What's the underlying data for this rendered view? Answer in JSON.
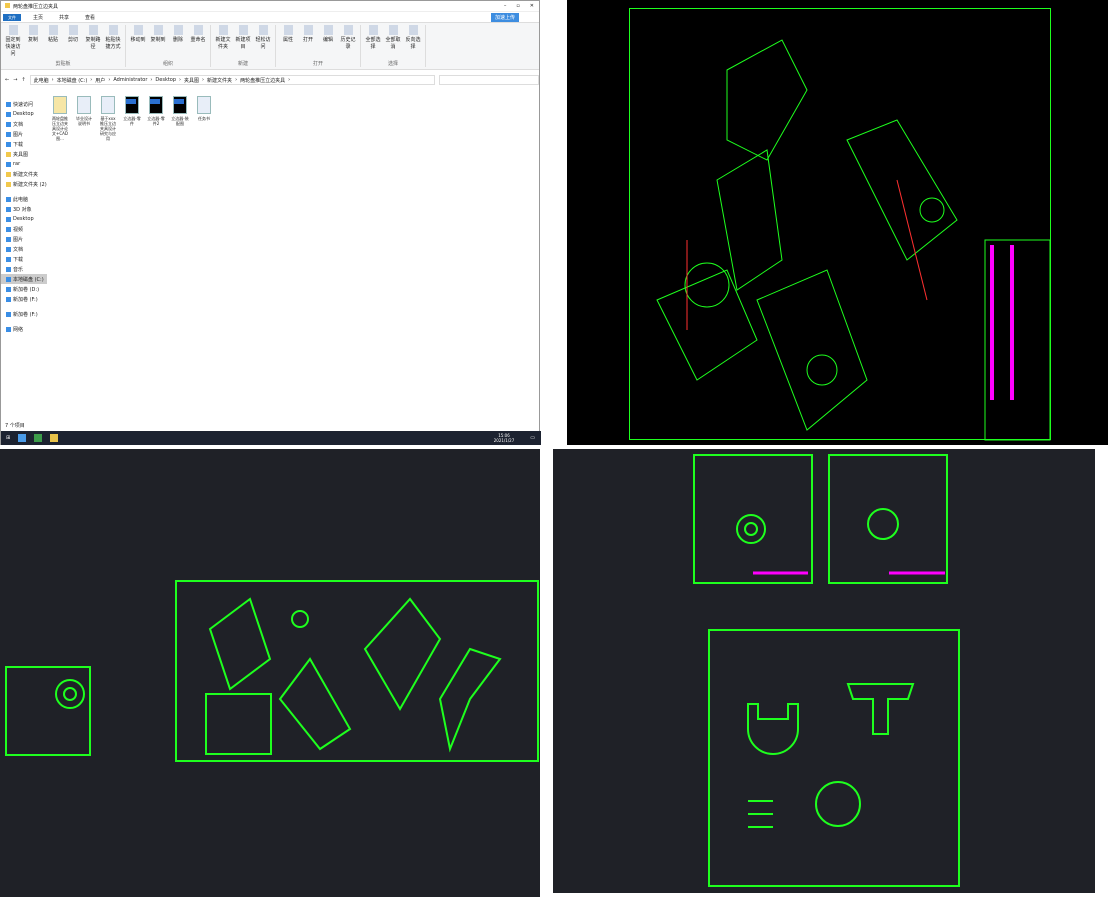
{
  "explorer": {
    "title": "两轮盘推压立边夹具",
    "tabs": [
      "文件",
      "主页",
      "共享",
      "查看"
    ],
    "ribbon": {
      "groups": [
        {
          "label": "剪贴板",
          "buttons": [
            "固定到快速访问",
            "复制",
            "粘贴",
            "剪切",
            "复制路径",
            "粘贴快捷方式"
          ]
        },
        {
          "label": "组织",
          "buttons": [
            "移动到",
            "复制到",
            "删除",
            "重命名"
          ]
        },
        {
          "label": "新建",
          "buttons": [
            "新建文件夹",
            "新建项目",
            "轻松访问"
          ]
        },
        {
          "label": "打开",
          "buttons": [
            "属性",
            "打开",
            "编辑",
            "历史记录"
          ]
        },
        {
          "label": "选择",
          "buttons": [
            "全部选择",
            "全部取消",
            "反向选择"
          ]
        }
      ],
      "cloud_button": "加速上传"
    },
    "breadcrumb": [
      "此电脑",
      "本地磁盘 (C:)",
      "用户",
      "Administrator",
      "Desktop",
      "夹具图",
      "新建文件夹",
      "两轮盘推压立边夹具"
    ],
    "nav": [
      {
        "label": "快速访问",
        "type": "head"
      },
      {
        "label": "Desktop"
      },
      {
        "label": "文档"
      },
      {
        "label": "图片"
      },
      {
        "label": "下载"
      },
      {
        "label": "夹具图",
        "folder": true
      },
      {
        "label": "rar"
      },
      {
        "label": "新建文件夹",
        "folder": true
      },
      {
        "label": "新建文件夹 (2)",
        "folder": true
      },
      {
        "label": "此电脑",
        "type": "head"
      },
      {
        "label": "3D 对象"
      },
      {
        "label": "Desktop"
      },
      {
        "label": "视频"
      },
      {
        "label": "图片"
      },
      {
        "label": "文档"
      },
      {
        "label": "下载"
      },
      {
        "label": "音乐"
      },
      {
        "label": "本地磁盘 (C:)",
        "selected": true
      },
      {
        "label": "新加卷 (D:)"
      },
      {
        "label": "新加卷 (F:)"
      },
      {
        "label": "新加卷 (F:)",
        "type": "head"
      },
      {
        "label": "网络",
        "type": "head"
      }
    ],
    "files": [
      {
        "name": "两轮盘推压立边夹具设计论文+CAD图...",
        "kind": "zip"
      },
      {
        "name": "毕业设计说明书",
        "kind": "doc"
      },
      {
        "name": "基于xxx推压立边夹具设计研究与应用",
        "kind": "doc"
      },
      {
        "name": "立边器-零件",
        "kind": "cad"
      },
      {
        "name": "立边器-零件2",
        "kind": "cad"
      },
      {
        "name": "立边器-装配图",
        "kind": "cad"
      },
      {
        "name": "任务书",
        "kind": "doc"
      }
    ],
    "status": "7 个项目",
    "clock": {
      "time": "15:06",
      "date": "2021/1/27"
    }
  },
  "colors": {
    "cad_green": "#1eff1e",
    "cad_magenta": "#ff00ff",
    "cad_red": "#ff3030",
    "cad_bg": "#000000"
  }
}
